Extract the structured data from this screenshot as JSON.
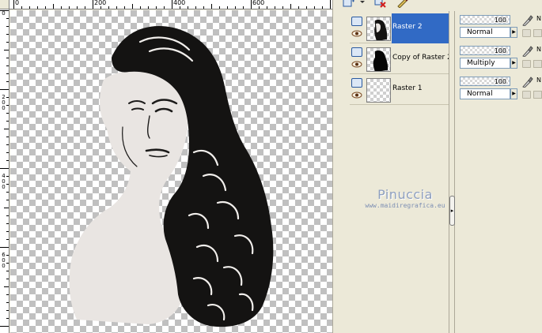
{
  "rulers": {
    "horizontal_labels": [
      "0",
      "200",
      "400",
      "600"
    ],
    "vertical_labels": [
      "0",
      "200",
      "400",
      "600"
    ]
  },
  "layers": [
    {
      "name": "Raster 2",
      "opacity": "100",
      "blend_mode": "Normal",
      "selected": true,
      "toggle": "N"
    },
    {
      "name": "Copy of Raster 2",
      "opacity": "100",
      "blend_mode": "Multiply",
      "selected": false,
      "toggle": "N"
    },
    {
      "name": "Raster 1",
      "opacity": "100",
      "blend_mode": "Normal",
      "selected": false,
      "toggle": "N"
    }
  ],
  "watermark": {
    "name": "Pinuccia",
    "url": "www.maidiregrafica.eu"
  },
  "colors": {
    "panel_bg": "#ece9d8",
    "selection": "#316ac5",
    "watermark": "#8e9fbf"
  },
  "icons": [
    "new-layer-icon",
    "delete-layer-icon",
    "edit-icon",
    "eye-icon",
    "brush-icon",
    "lock-icon",
    "mask-icon",
    "raster-layer-icon"
  ]
}
